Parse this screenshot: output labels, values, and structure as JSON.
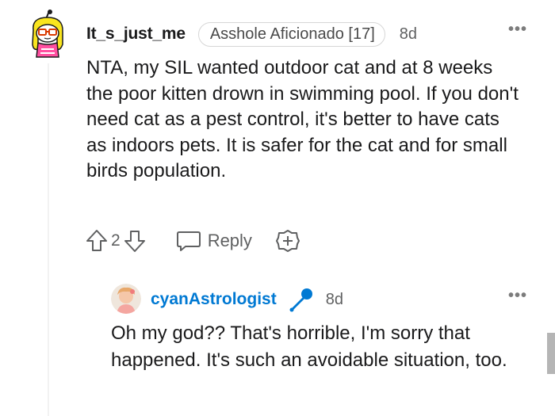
{
  "comment": {
    "username": "It_s_just_me",
    "flair": "Asshole Aficionado [17]",
    "time": "8d",
    "more_label": "•••",
    "body": "NTA, my SIL wanted outdoor cat and at 8 weeks the poor kitten drown in swimming pool. If you don't need cat as a pest control, it's better to have cats as indoors pets. It is safer for the cat and for small birds population.",
    "vote_count": "2",
    "reply_label": "Reply",
    "avatar_icon": "snoo-avatar-icon"
  },
  "reply": {
    "username": "cyanAstrologist",
    "time": "8d",
    "more_label": "•••",
    "body": "Oh my god?? That's horrible, I'm sorry that happened. It's such an avoidable situation, too.",
    "badge_icon": "microphone-icon",
    "avatar_icon": "user-avatar-icon"
  },
  "colors": {
    "username_link": "#0079d3",
    "meta_gray": "#5f6061",
    "text": "#1a1a1b"
  }
}
